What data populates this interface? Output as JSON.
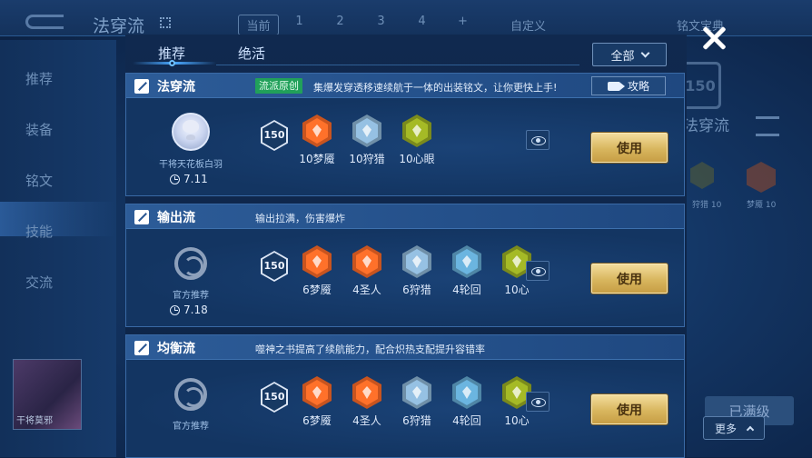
{
  "background": {
    "title": "法穿流",
    "pages": [
      "当前",
      "1",
      "2",
      "3",
      "4",
      "+"
    ],
    "custom_label": "自定义",
    "book_label": "铭文宝典",
    "sidebar": [
      "推荐",
      "装备",
      "铭文",
      "技能",
      "交流"
    ],
    "hero_name": "干将莫邪",
    "right_level": "150",
    "right_title": "法穿流",
    "right_gem_label_1": "狩猎 10",
    "right_gem_label_2": "梦魇 10",
    "maxed_label": "已满级",
    "more_label": "更多"
  },
  "modal": {
    "tabs": [
      "推荐",
      "绝活"
    ],
    "filter_label": "全部",
    "guide_label": "攻略",
    "use_label": "使用",
    "origin_tag": "流派原创",
    "level": "150",
    "cards": [
      {
        "name": "法穿流",
        "desc": "集爆发穿透移速续航于一体的出装铭文，让你更快上手!",
        "author": "干将天花板白羽",
        "date": "7.11",
        "runes": [
          {
            "label": "10梦魇",
            "color": "#c8541f"
          },
          {
            "label": "10狩猎",
            "color": "#6f8fa8"
          },
          {
            "label": "10心眼",
            "color": "#7a8a1c"
          }
        ]
      },
      {
        "name": "输出流",
        "desc": "输出拉满，伤害爆炸",
        "author": "官方推荐",
        "date": "7.18",
        "runes": [
          {
            "label": "6梦魇",
            "color": "#c8541f"
          },
          {
            "label": "4圣人",
            "color": "#c8541f"
          },
          {
            "label": "6狩猎",
            "color": "#6f8fa8"
          },
          {
            "label": "4轮回",
            "color": "#4f86a6"
          },
          {
            "label": "10心",
            "color": "#7a8a1c"
          }
        ]
      },
      {
        "name": "均衡流",
        "desc": "噬神之书提高了续航能力，配合炽热支配提升容错率",
        "author": "官方推荐",
        "date": "",
        "runes": [
          {
            "label": "6梦魇",
            "color": "#c8541f"
          },
          {
            "label": "4圣人",
            "color": "#c8541f"
          },
          {
            "label": "6狩猎",
            "color": "#6f8fa8"
          },
          {
            "label": "4轮回",
            "color": "#4f86a6"
          },
          {
            "label": "10心",
            "color": "#7a8a1c"
          }
        ]
      }
    ]
  }
}
